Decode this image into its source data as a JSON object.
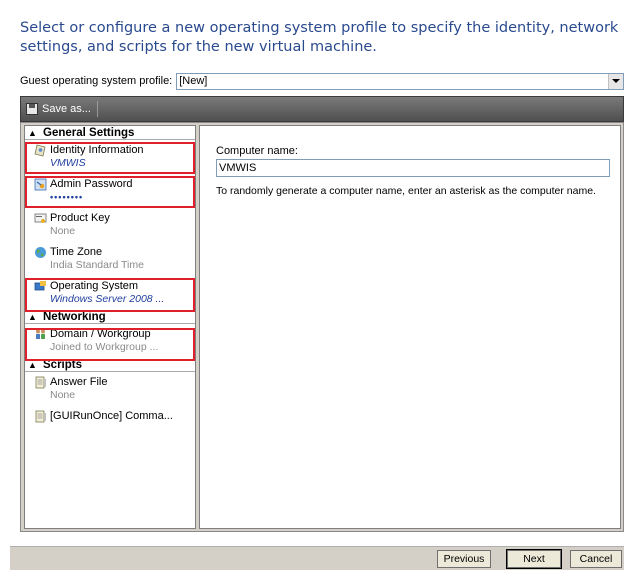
{
  "header": {
    "description": "Select or configure a new operating system profile to specify the identity, network settings, and scripts for the new virtual machine."
  },
  "profile": {
    "label": "Guest operating system profile:",
    "value": "[New]"
  },
  "toolbar": {
    "save_label": "Save as..."
  },
  "sections": [
    {
      "title": "General Settings",
      "items": [
        {
          "label": "Identity Information",
          "sub": "VMWIS",
          "icon": "identity-icon"
        },
        {
          "label": "Admin Password",
          "sub": "••••••••",
          "icon": "password-key-icon"
        },
        {
          "label": "Product Key",
          "sub": "None",
          "icon": "product-key-icon"
        },
        {
          "label": "Time Zone",
          "sub": "India Standard Time",
          "icon": "globe-icon"
        },
        {
          "label": "Operating System",
          "sub": "Windows Server 2008 ...",
          "icon": "operating-system-icon"
        }
      ]
    },
    {
      "title": "Networking",
      "items": [
        {
          "label": "Domain / Workgroup",
          "sub": "Joined to Workgroup ...",
          "icon": "network-users-icon"
        }
      ]
    },
    {
      "title": "Scripts",
      "items": [
        {
          "label": "Answer File",
          "sub": "None",
          "icon": "script-file-icon"
        },
        {
          "label": "[GUIRunOnce] Comma...",
          "sub": "",
          "icon": "script-file-icon"
        }
      ]
    }
  ],
  "detail": {
    "field_label": "Computer name:",
    "field_value": "VMWIS",
    "hint": "To randomly generate a computer name, enter an asterisk as the computer name."
  },
  "buttons": {
    "previous": "Previous",
    "next": "Next",
    "cancel": "Cancel"
  },
  "colors": {
    "header_text": "#2a4a8e",
    "highlight_border": "#e0202a",
    "toolbar_bg": "#5f5f5f",
    "italic_value": "#1f3e9e"
  }
}
